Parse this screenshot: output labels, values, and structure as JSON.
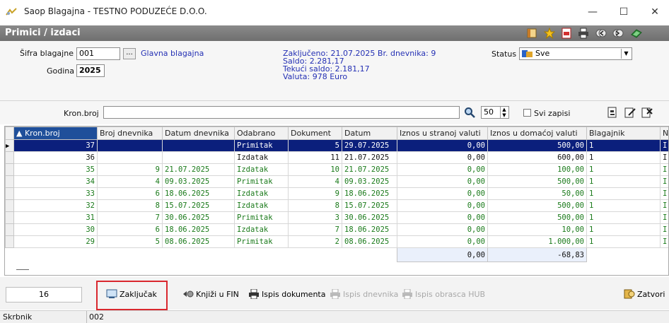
{
  "window": {
    "title": "Saop Blagajna - TESTNO PODUZEĆE D.O.O.",
    "controls": {
      "minimize": "—",
      "maximize": "☐",
      "close": "✕"
    }
  },
  "header": {
    "title": "Primici / izdaci",
    "icons": [
      "layout-icon",
      "star-icon",
      "pdf-icon",
      "printer-icon",
      "left-arrows-icon",
      "right-arrows-icon",
      "book-icon"
    ]
  },
  "form": {
    "sifra_label": "Šifra blagajne",
    "sifra_value": "001",
    "lookup_label": "...",
    "sifra_name": "Glavna blagajna",
    "godina_label": "Godina",
    "godina_value": "2025",
    "info_lines": [
      "Zaključeno: 21.07.2025 Br. dnevnika: 9",
      "Saldo:  2.281,17",
      "Tekući saldo: 2.181,17",
      "Valuta: 978 Euro"
    ],
    "status_label": "Status",
    "status_value": "Sve"
  },
  "filter": {
    "kron_label": "Kron.broj",
    "kron_value": "",
    "limit_value": "50",
    "svi_zapisi_label": "Svi zapisi"
  },
  "grid": {
    "columns": [
      "▲ Kron.broj",
      "Broj dnevnika",
      "Datum dnevnika",
      "Odabrano",
      "Dokument",
      "Datum",
      "Iznos u stranoj valuti",
      "Iznos u domaćoj valuti",
      "Blagajnik",
      "N"
    ],
    "rows": [
      {
        "kron": "37",
        "broj_dn": "",
        "datum_dn": "",
        "odabrano": "Primitak",
        "dok": "5",
        "datum": "29.07.2025",
        "strana": "0,00",
        "domaca": "500,00",
        "blag": "1",
        "n": "I",
        "style": "sel"
      },
      {
        "kron": "36",
        "broj_dn": "",
        "datum_dn": "",
        "odabrano": "Izdatak",
        "dok": "11",
        "datum": "21.07.2025",
        "strana": "0,00",
        "domaca": "600,00",
        "blag": "1",
        "n": "I",
        "style": "black"
      },
      {
        "kron": "35",
        "broj_dn": "9",
        "datum_dn": "21.07.2025",
        "odabrano": "Izdatak",
        "dok": "10",
        "datum": "21.07.2025",
        "strana": "0,00",
        "domaca": "100,00",
        "blag": "1",
        "n": "I",
        "style": "green"
      },
      {
        "kron": "34",
        "broj_dn": "4",
        "datum_dn": "09.03.2025",
        "odabrano": "Primitak",
        "dok": "4",
        "datum": "09.03.2025",
        "strana": "0,00",
        "domaca": "500,00",
        "blag": "1",
        "n": "I",
        "style": "green"
      },
      {
        "kron": "33",
        "broj_dn": "6",
        "datum_dn": "18.06.2025",
        "odabrano": "Izdatak",
        "dok": "9",
        "datum": "18.06.2025",
        "strana": "0,00",
        "domaca": "50,00",
        "blag": "1",
        "n": "I",
        "style": "green"
      },
      {
        "kron": "32",
        "broj_dn": "8",
        "datum_dn": "15.07.2025",
        "odabrano": "Izdatak",
        "dok": "8",
        "datum": "15.07.2025",
        "strana": "0,00",
        "domaca": "500,00",
        "blag": "1",
        "n": "I",
        "style": "green"
      },
      {
        "kron": "31",
        "broj_dn": "7",
        "datum_dn": "30.06.2025",
        "odabrano": "Primitak",
        "dok": "3",
        "datum": "30.06.2025",
        "strana": "0,00",
        "domaca": "500,00",
        "blag": "1",
        "n": "I",
        "style": "green"
      },
      {
        "kron": "30",
        "broj_dn": "6",
        "datum_dn": "18.06.2025",
        "odabrano": "Izdatak",
        "dok": "7",
        "datum": "18.06.2025",
        "strana": "0,00",
        "domaca": "10,00",
        "blag": "1",
        "n": "I",
        "style": "green"
      },
      {
        "kron": "29",
        "broj_dn": "5",
        "datum_dn": "08.06.2025",
        "odabrano": "Primitak",
        "dok": "2",
        "datum": "08.06.2025",
        "strana": "0,00",
        "domaca": "1.000,00",
        "blag": "1",
        "n": "I",
        "style": "green"
      }
    ],
    "totals": {
      "strana": "0,00",
      "domaca": "-68,83"
    }
  },
  "actions": {
    "count": "16",
    "zakljucak": "Zaključak",
    "knjizi": "Knjiži u FIN",
    "ispis_dok": "Ispis dokumenta",
    "ispis_dnevnika": "Ispis dnevnika",
    "ispis_hub": "Ispis obrasca HUB",
    "zatvori": "Zatvori"
  },
  "statusbar": {
    "label": "Skrbnik",
    "value": "002"
  }
}
